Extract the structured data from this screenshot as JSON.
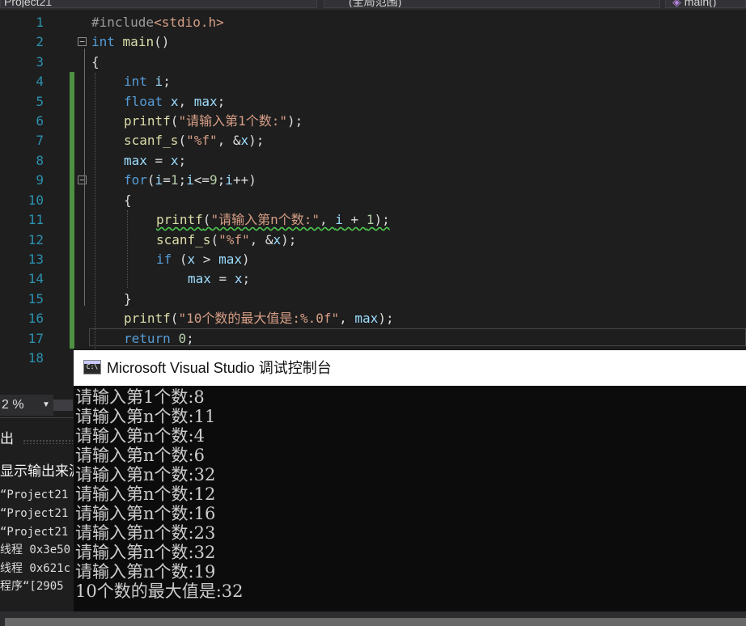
{
  "navbar": {
    "project": "Project21",
    "scope": "(全局范围)",
    "function": "main()"
  },
  "editor": {
    "line_numbers": [
      "1",
      "2",
      "3",
      "4",
      "5",
      "6",
      "7",
      "8",
      "9",
      "10",
      "11",
      "12",
      "13",
      "14",
      "15",
      "16",
      "17",
      "18"
    ],
    "code": {
      "l1_pp": "#include",
      "l1_inc": "<stdio.h>",
      "l2_kw": "int",
      "l2_fn": "main",
      "l2_rest": "()",
      "l3": "{",
      "l4_kw": "int",
      "l4_var": "i",
      "l4_end": ";",
      "l5_kw": "float",
      "l5_var1": "x",
      "l5_sep": ", ",
      "l5_var2": "max",
      "l5_end": ";",
      "l6_fn": "printf",
      "l6_open": "(",
      "l6_str": "\"请输入第1个数:\"",
      "l6_end": ");",
      "l7_fn": "scanf_s",
      "l7_open": "(",
      "l7_str": "\"%f\"",
      "l7_mid": ", &",
      "l7_var": "x",
      "l7_end": ");",
      "l8_var1": "max",
      "l8_mid": " = ",
      "l8_var2": "x",
      "l8_end": ";",
      "l9_kw": "for",
      "l9_open": "(",
      "l9_v1": "i",
      "l9_a": "=",
      "l9_n1": "1",
      "l9_b": ";",
      "l9_v2": "i",
      "l9_c": "<=",
      "l9_n2": "9",
      "l9_d": ";",
      "l9_v3": "i",
      "l9_e": "++)",
      "l10": "{",
      "l11_fn": "printf",
      "l11_open": "(",
      "l11_str": "\"请输入第n个数:\"",
      "l11_mid": ", ",
      "l11_var": "i",
      "l11_plus": " + ",
      "l11_num": "1",
      "l11_end": ");",
      "l12_fn": "scanf_s",
      "l12_open": "(",
      "l12_str": "\"%f\"",
      "l12_mid": ", &",
      "l12_var": "x",
      "l12_end": ");",
      "l13_kw": "if",
      "l13_open": " (",
      "l13_v1": "x",
      "l13_op": " > ",
      "l13_v2": "max",
      "l13_end": ")",
      "l14_v1": "max",
      "l14_mid": " = ",
      "l14_v2": "x",
      "l14_end": ";",
      "l15": "}",
      "l16_fn": "printf",
      "l16_open": "(",
      "l16_str": "\"10个数的最大值是:%.0f\"",
      "l16_mid": ", ",
      "l16_var": "max",
      "l16_end": ");",
      "l17_kw": "return",
      "l17_num": "0",
      "l17_end": ";"
    }
  },
  "zoom": {
    "value": "2 %"
  },
  "output_panel": {
    "title": "出",
    "source_label": "显示输出来源",
    "lines": [
      "“Project21",
      "“Project21",
      "“Project21",
      "线程 0x3e50",
      "线程 0x621c",
      "程序“[2905"
    ]
  },
  "console": {
    "icon_text": "C:\\",
    "title": "Microsoft Visual Studio 调试控制台",
    "lines": [
      "请输入第1个数:8",
      "请输入第n个数:11",
      "请输入第n个数:4",
      "请输入第n个数:6",
      "请输入第n个数:32",
      "请输入第n个数:12",
      "请输入第n个数:16",
      "请输入第n个数:23",
      "请输入第n个数:32",
      "请输入第n个数:19",
      "10个数的最大值是:32"
    ]
  },
  "colors": {
    "editor_bg": "#1e1e1e",
    "keyword": "#569cd6",
    "function": "#dcdcaa",
    "string": "#d69d85",
    "variable": "#9cdcfe",
    "number": "#b5cea8",
    "line_number": "#2b91af",
    "console_bg": "#0c0c0c"
  }
}
